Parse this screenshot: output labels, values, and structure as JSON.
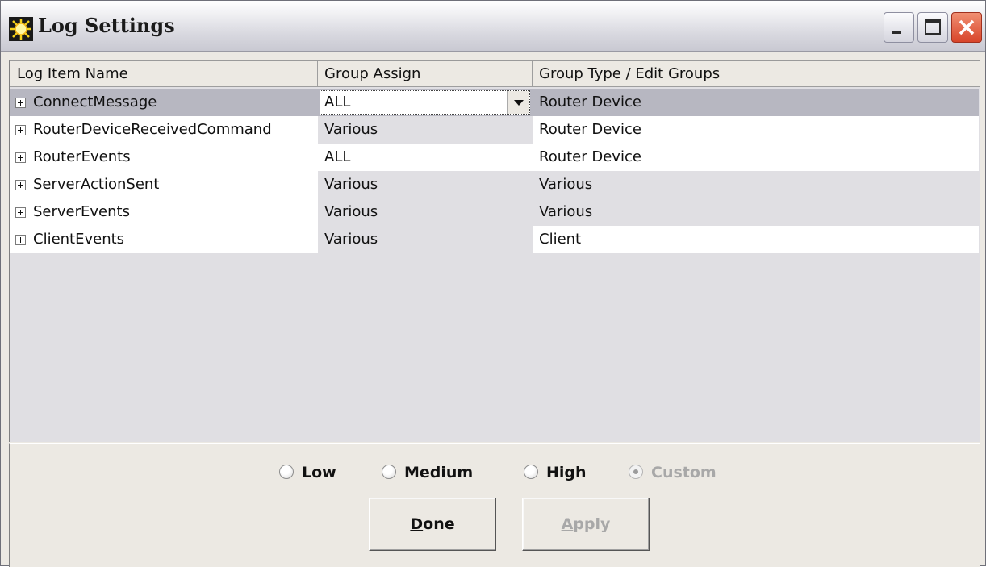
{
  "window": {
    "title": "Log Settings"
  },
  "columns": [
    "Log Item Name",
    "Group Assign",
    "Group Type / Edit Groups"
  ],
  "rows": [
    {
      "name": "ConnectMessage",
      "group_assign": "ALL",
      "group_type": "Router Device",
      "selected": true
    },
    {
      "name": "RouterDeviceReceivedCommand",
      "group_assign": "Various",
      "group_type": "Router Device"
    },
    {
      "name": "RouterEvents",
      "group_assign": "ALL",
      "group_type": "Router Device"
    },
    {
      "name": "ServerActionSent",
      "group_assign": "Various",
      "group_type": "Various"
    },
    {
      "name": "ServerEvents",
      "group_assign": "Various",
      "group_type": "Various"
    },
    {
      "name": "ClientEvents",
      "group_assign": "Various",
      "group_type": "Client"
    }
  ],
  "levels": {
    "low": "Low",
    "medium": "Medium",
    "high": "High",
    "custom": "Custom",
    "selected": "Custom"
  },
  "buttons": {
    "done_mnemonic": "D",
    "done_rest": "one",
    "apply_mnemonic": "A",
    "apply_rest": "pply"
  },
  "icons": {
    "app": "sun-icon",
    "minimize": "minimize-icon",
    "maximize": "maximize-icon",
    "close": "close-icon",
    "expand": "plus-box-icon",
    "dropdown": "dropdown-arrow-icon"
  }
}
